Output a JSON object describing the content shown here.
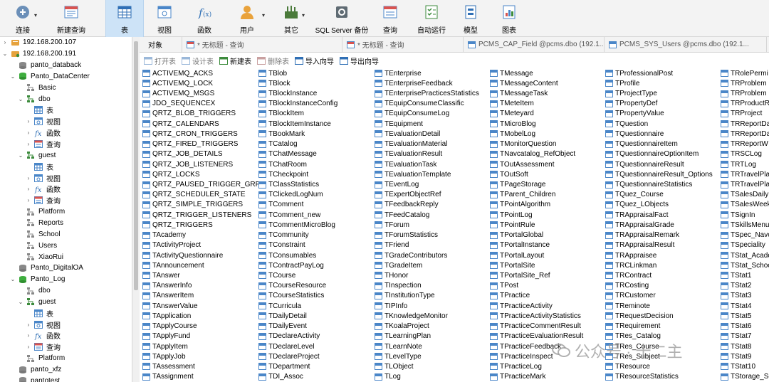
{
  "toolbar": {
    "items": [
      {
        "label": "连接",
        "icon": "plug-connect-icon",
        "dropdown": true
      },
      {
        "label": "新建查询",
        "icon": "new-query-icon"
      },
      {
        "label": "表",
        "icon": "table-icon",
        "active": true
      },
      {
        "label": "视图",
        "icon": "view-icon"
      },
      {
        "label": "函数",
        "icon": "function-icon"
      },
      {
        "label": "用户",
        "icon": "user-icon",
        "dropdown": true
      },
      {
        "label": "其它",
        "icon": "tools-icon",
        "dropdown": true
      },
      {
        "label": "SQL Server 备份",
        "icon": "backup-icon"
      },
      {
        "label": "查询",
        "icon": "query-icon"
      },
      {
        "label": "自动运行",
        "icon": "auto-run-icon"
      },
      {
        "label": "模型",
        "icon": "model-icon"
      },
      {
        "label": "图表",
        "icon": "chart-icon"
      }
    ]
  },
  "sidebar": {
    "items": [
      {
        "label": "192.168.200.107",
        "level": 0,
        "type": "server",
        "arrow": "›"
      },
      {
        "label": "192.168.200.191",
        "level": 0,
        "type": "server-open",
        "arrow": "⌄"
      },
      {
        "label": "panto_databack",
        "level": 1,
        "type": "db"
      },
      {
        "label": "Panto_DataCenter",
        "level": 1,
        "type": "db-open",
        "arrow": "⌄"
      },
      {
        "label": "Basic",
        "level": 2,
        "type": "schema"
      },
      {
        "label": "dbo",
        "level": 2,
        "type": "schema-open",
        "arrow": "⌄"
      },
      {
        "label": "表",
        "level": 3,
        "type": "table"
      },
      {
        "label": "视图",
        "level": 3,
        "type": "view",
        "arrow": "›"
      },
      {
        "label": "函数",
        "level": 3,
        "type": "func",
        "arrow": "›"
      },
      {
        "label": "查询",
        "level": 3,
        "type": "query",
        "arrow": "›"
      },
      {
        "label": "guest",
        "level": 2,
        "type": "schema-open",
        "arrow": "⌄"
      },
      {
        "label": "表",
        "level": 3,
        "type": "table"
      },
      {
        "label": "视图",
        "level": 3,
        "type": "view",
        "arrow": "›"
      },
      {
        "label": "函数",
        "level": 3,
        "type": "func",
        "arrow": "›"
      },
      {
        "label": "查询",
        "level": 3,
        "type": "query",
        "arrow": "›"
      },
      {
        "label": "Platform",
        "level": 2,
        "type": "schema"
      },
      {
        "label": "Reports",
        "level": 2,
        "type": "schema"
      },
      {
        "label": "School",
        "level": 2,
        "type": "schema"
      },
      {
        "label": "Users",
        "level": 2,
        "type": "schema"
      },
      {
        "label": "XiaoRui",
        "level": 2,
        "type": "schema"
      },
      {
        "label": "Panto_DigitalOA",
        "level": 1,
        "type": "db"
      },
      {
        "label": "Panto_Log",
        "level": 1,
        "type": "db-open",
        "arrow": "⌄"
      },
      {
        "label": "dbo",
        "level": 2,
        "type": "schema"
      },
      {
        "label": "guest",
        "level": 2,
        "type": "schema-open",
        "arrow": "⌄"
      },
      {
        "label": "表",
        "level": 3,
        "type": "table"
      },
      {
        "label": "视图",
        "level": 3,
        "type": "view",
        "arrow": "›"
      },
      {
        "label": "函数",
        "level": 3,
        "type": "func",
        "arrow": "›"
      },
      {
        "label": "查询",
        "level": 3,
        "type": "query",
        "arrow": "›"
      },
      {
        "label": "Platform",
        "level": 2,
        "type": "schema"
      },
      {
        "label": "panto_xfz",
        "level": 1,
        "type": "db"
      },
      {
        "label": "pantotest",
        "level": 1,
        "type": "db"
      }
    ]
  },
  "tabs": [
    {
      "label": "对象"
    },
    {
      "label": "* 无标题 - 查询"
    },
    {
      "label": "* 无标题 - 查询"
    },
    {
      "label": "PCMS_CAP_Field @pcms.dbo (192.1..."
    },
    {
      "label": "PCMS_SYS_Users @pcms.dbo (192.1..."
    }
  ],
  "subtoolbar": [
    {
      "label": "打开表",
      "enabled": false,
      "icon": "open-table-icon"
    },
    {
      "label": "设计表",
      "enabled": false,
      "icon": "design-table-icon"
    },
    {
      "label": "新建表",
      "enabled": true,
      "icon": "new-table-icon"
    },
    {
      "label": "删除表",
      "enabled": false,
      "icon": "delete-table-icon"
    },
    {
      "label": "导入向导",
      "enabled": true,
      "icon": "import-wizard-icon"
    },
    {
      "label": "导出向导",
      "enabled": true,
      "icon": "export-wizard-icon"
    }
  ],
  "tables": {
    "columns": [
      [
        "ACTIVEMQ_ACKS",
        "ACTIVEMQ_LOCK",
        "ACTIVEMQ_MSGS",
        "JDO_SEQUENCEX",
        "QRTZ_BLOB_TRIGGERS",
        "QRTZ_CALENDARS",
        "QRTZ_CRON_TRIGGERS",
        "QRTZ_FIRED_TRIGGERS",
        "QRTZ_JOB_DETAILS",
        "QRTZ_JOB_LISTENERS",
        "QRTZ_LOCKS",
        "QRTZ_PAUSED_TRIGGER_GRPS",
        "QRTZ_SCHEDULER_STATE",
        "QRTZ_SIMPLE_TRIGGERS",
        "QRTZ_TRIGGER_LISTENERS",
        "QRTZ_TRIGGERS",
        "TAcademy",
        "TActivityProject",
        "TActivityQuestionnaire",
        "TAnnouncement",
        "TAnswer",
        "TAnswerInfo",
        "TAnswerItem",
        "TAnswerValue",
        "TApplication",
        "TApplyCourse",
        "TApplyFund",
        "TApplyItem",
        "TApplyJob",
        "TAssessment",
        "TAssignment"
      ],
      [
        "TBlob",
        "TBlock",
        "TBlockInstance",
        "TBlockInstanceConfig",
        "TBlockItem",
        "TBlockItemInstance",
        "TBookMark",
        "TCatalog",
        "TChatMessage",
        "TChatRoom",
        "TCheckpoint",
        "TClassStatistics",
        "TClickedLogNum",
        "TComment",
        "TComment_new",
        "TCommentMicroBlog",
        "TCommunity",
        "TConstraint",
        "TConsumables",
        "TContractPayLog",
        "TCourse",
        "TCourseResource",
        "TCourseStatistics",
        "TCurricula",
        "TDailyDetail",
        "TDailyEvent",
        "TDeclareActivity",
        "TDeclareLevel",
        "TDeclareProject",
        "TDepartment",
        "TDI_Assoc"
      ],
      [
        "TEnterprise",
        "TEnterpriseFeedback",
        "TEnterprisePracticesStatistics",
        "TEquipConsumeClassific",
        "TEquipConsumeLog",
        "TEquipment",
        "TEvaluationDetail",
        "TEvaluationMaterial",
        "TEvaluationResult",
        "TEvaluationTask",
        "TEvaluationTemplate",
        "TEventLog",
        "TExpertObjectRef",
        "TFeedbackReply",
        "TFeedCatalog",
        "TForum",
        "TForumStatistics",
        "TFriend",
        "TGradeContributors",
        "TGradeItem",
        "THonor",
        "TInspection",
        "TInstitutionType",
        "TIPInfo",
        "TKnowledgeMonitor",
        "TKoalaProject",
        "TLearningPlan",
        "TLearnNote",
        "TLevelType",
        "TLObject",
        "TLog"
      ],
      [
        "TMessage",
        "TMessageContent",
        "TMessageTask",
        "TMeteItem",
        "TMeteyard",
        "TMicroBlog",
        "TMobelLog",
        "TMonitorQuestion",
        "TNavcatalog_RefObject",
        "TOutAssessment",
        "TOutSoft",
        "TPageStorage",
        "TParent_Children",
        "TPointAlgorithm",
        "TPointLog",
        "TPointRule",
        "TPortalGlobal",
        "TPortalInstance",
        "TPortalLayout",
        "TPortalSite",
        "TPortalSite_Ref",
        "TPost",
        "TPractice",
        "TPracticeActivity",
        "TPracticeActivityStatistics",
        "TPracticeCommentResult",
        "TPracticeEvaluationResult",
        "TPracticeFeedback",
        "TPracticeInspect",
        "TPracticeLog",
        "TPracticeMark"
      ],
      [
        "TProfessionalPost",
        "TProfile",
        "TProjectType",
        "TPropertyDef",
        "TPropertyValue",
        "TQuestion",
        "TQuestionnaire",
        "TQuestionnaireItem",
        "TQuestionnaireOptionItem",
        "TQuestionnaireResult",
        "TQuestionnaireResult_Options",
        "TQuestionnaireStatistics",
        "TQuez_Course",
        "TQuez_LObjects",
        "TRAppraisalFact",
        "TRAppraisalGrade",
        "TRAppraisalRemark",
        "TRAppraisalResult",
        "TRAppraisee",
        "TRCLinkman",
        "TRContract",
        "TRCosting",
        "TRCustomer",
        "TReminote",
        "TRequestDecision",
        "TRequirement",
        "TRes_Catalog",
        "TRes_Course",
        "TRes_Subject",
        "TResource",
        "TResourceStatistics"
      ],
      [
        "TRolePermi",
        "TRProblem",
        "TRProblem",
        "TRProductR",
        "TRProject",
        "TRReportDa",
        "TRReportDa",
        "TRReportW",
        "TRSCLog",
        "TRTLog",
        "TRTravelPla",
        "TRTravelPla",
        "TSalesDaily",
        "TSalesWeek",
        "TSignIn",
        "TSkillsMenu",
        "TSpec_Navo",
        "TSpeciality",
        "TStat_Acade",
        "TStat_Schoo",
        "TStat1",
        "TStat2",
        "TStat3",
        "TStat4",
        "TStat5",
        "TStat6",
        "TStat7",
        "TStat8",
        "TStat9",
        "TStat10",
        "TStorage_Sc"
      ]
    ]
  },
  "watermark": {
    "text": "公众号 · 十二主"
  }
}
